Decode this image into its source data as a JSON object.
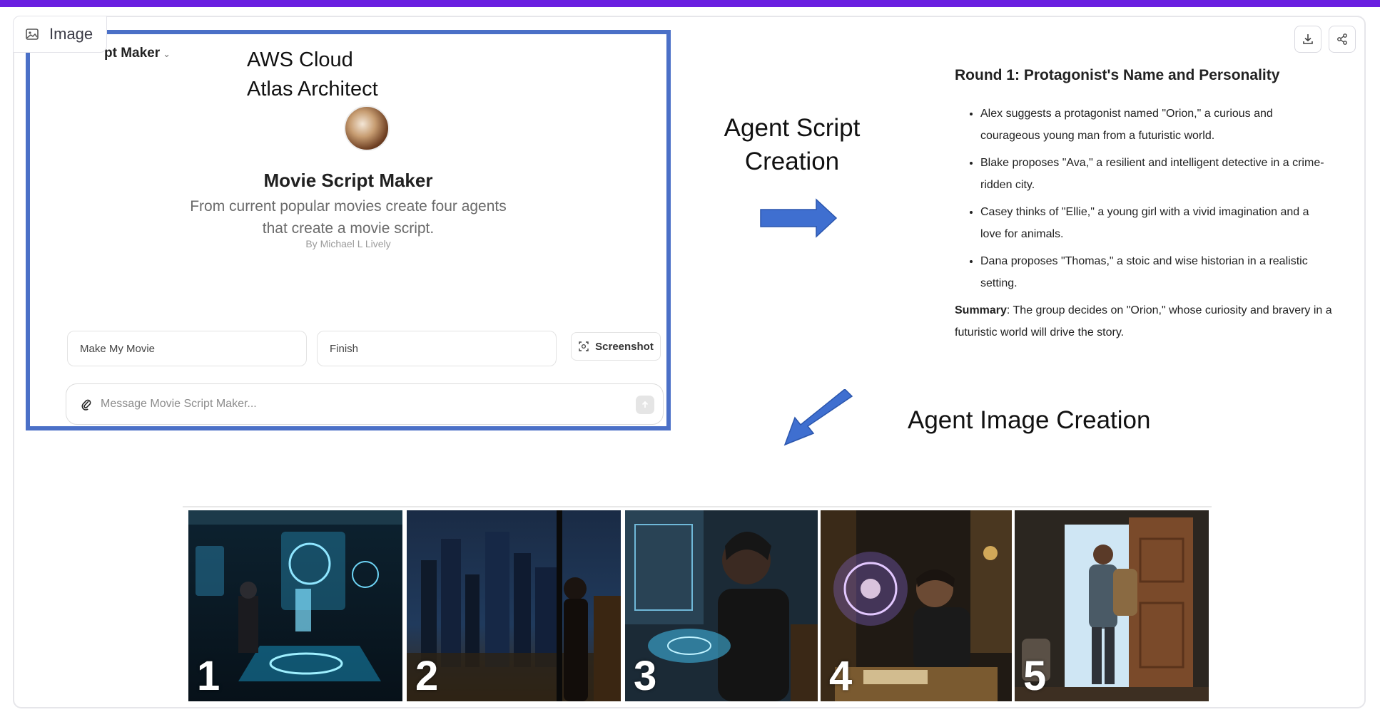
{
  "viewer": {
    "tag_label": "Image",
    "tag_icon": "image-icon",
    "download_icon": "download-icon",
    "share_icon": "share-icon"
  },
  "gpt_panel": {
    "title": "pt Maker",
    "overlay_line1": "AWS Cloud",
    "overlay_line2": "Atlas Architect",
    "bot_name": "Movie Script Maker",
    "description_line1": "From current popular movies create four agents",
    "description_line2": "that create a movie script.",
    "author": "By Michael L Lively",
    "starters": [
      "Make My Movie",
      "Finish"
    ],
    "screenshot_label": "Screenshot",
    "message_placeholder": "Message Movie Script Maker..."
  },
  "labels": {
    "script_line1": "Agent Script",
    "script_line2": "Creation",
    "image_creation": "Agent Image Creation"
  },
  "script": {
    "heading": "Round 1: Protagonist's Name and Personality",
    "bullets": [
      "Alex suggests a protagonist named \"Orion,\" a curious and courageous young man from a futuristic world.",
      "Blake proposes \"Ava,\" a resilient and intelligent detective in a crime-ridden city.",
      "Casey thinks of \"Ellie,\" a young girl with a vivid imagination and a love for animals.",
      "Dana proposes \"Thomas,\" a stoic and wise historian in a realistic setting."
    ],
    "summary_label": "Summary",
    "summary_text": ": The group decides on \"Orion,\" whose curiosity and bravery in a futuristic world will drive the story."
  },
  "images": [
    {
      "num": "1",
      "scene": "holographic lab with man and glowing figure"
    },
    {
      "num": "2",
      "scene": "man at window overlooking night city skyline"
    },
    {
      "num": "3",
      "scene": "man with holographic tablet in futuristic room"
    },
    {
      "num": "4",
      "scene": "man reading in library with glowing hologram"
    },
    {
      "num": "5",
      "scene": "man with backpack opening a door"
    }
  ],
  "colors": {
    "frame": "#6a1fe0",
    "panel_border": "#4b70c7",
    "arrow": "#3f6fd0"
  }
}
